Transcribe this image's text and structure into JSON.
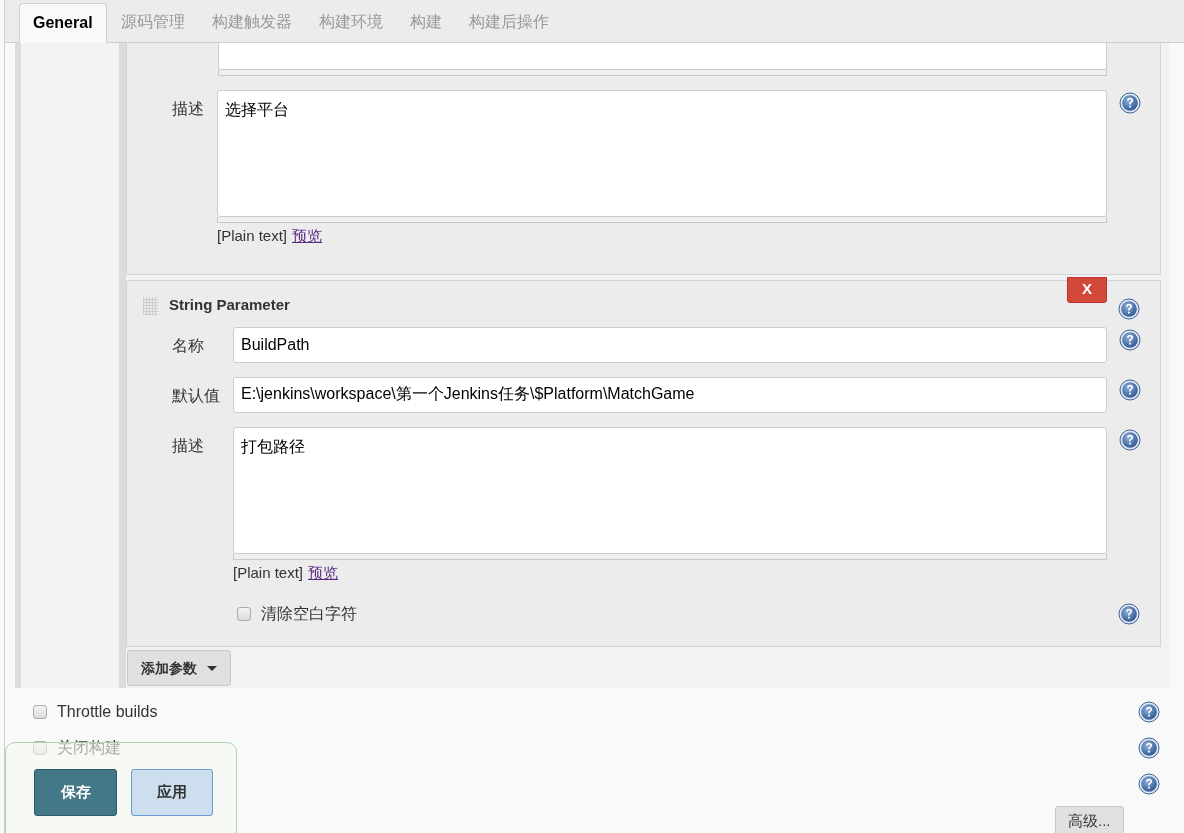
{
  "tabs": [
    {
      "label": "General",
      "selected": true
    },
    {
      "label": "源码管理",
      "selected": false
    },
    {
      "label": "构建触发器",
      "selected": false
    },
    {
      "label": "构建环境",
      "selected": false
    },
    {
      "label": "构建",
      "selected": false
    },
    {
      "label": "构建后操作",
      "selected": false
    }
  ],
  "parameters": [
    {
      "kind": "partial",
      "fields": [
        {
          "kind": "textarea_cut"
        },
        {
          "kind": "textarea",
          "label": "描述",
          "value": "选择平台"
        }
      ],
      "format_note": "[Plain text]",
      "preview_link": "预览"
    },
    {
      "kind": "string",
      "title": "String Parameter",
      "delete_label": "X",
      "fields": [
        {
          "kind": "input",
          "label": "名称",
          "value": "BuildPath"
        },
        {
          "kind": "input",
          "label": "默认值",
          "value": "E:\\jenkins\\workspace\\第一个Jenkins任务\\$Platform\\MatchGame"
        },
        {
          "kind": "textarea",
          "label": "描述",
          "value": "打包路径"
        }
      ],
      "format_note": "[Plain text]",
      "preview_link": "预览",
      "trim": {
        "label": "清除空白字符",
        "checked": false
      }
    }
  ],
  "add_parameter_button": "添加参数",
  "options": [
    {
      "label": "Throttle builds",
      "checked": false
    },
    {
      "label": "关闭构建",
      "checked": false
    }
  ],
  "save_button": "保存",
  "apply_button": "应用",
  "advanced_button": "高级..."
}
